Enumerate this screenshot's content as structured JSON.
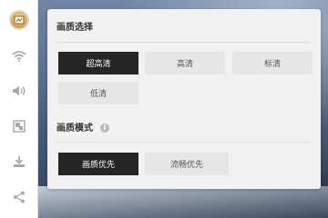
{
  "sidebar": {
    "items": [
      {
        "name": "avatar",
        "icon": "avatar-icon"
      },
      {
        "name": "wifi",
        "icon": "wifi-icon"
      },
      {
        "name": "volume",
        "icon": "volume-icon"
      },
      {
        "name": "screen",
        "icon": "screen-icon"
      },
      {
        "name": "download",
        "icon": "download-icon"
      },
      {
        "name": "share",
        "icon": "share-icon"
      }
    ]
  },
  "quality": {
    "title": "画质选择",
    "options": [
      "超高清",
      "高清",
      "标清",
      "低清"
    ],
    "selected": "超高清"
  },
  "mode": {
    "title": "画质模式",
    "info_icon": "i",
    "options": [
      "画质优先",
      "流畅优先"
    ],
    "selected": "画质优先"
  },
  "colors": {
    "selected_bg": "#252525",
    "option_bg": "#e6e6e6",
    "panel_bg": "#f1f1f1"
  }
}
